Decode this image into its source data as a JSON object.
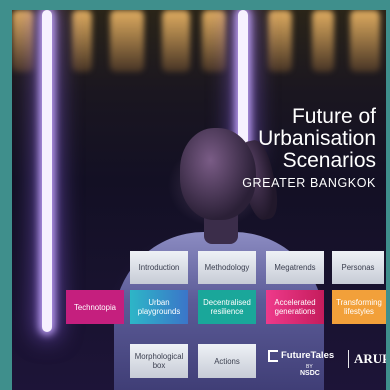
{
  "title_lines": [
    "Future of",
    "Urbanisation",
    "Scenarios"
  ],
  "subtitle": "GREATER BANGKOK",
  "nav": {
    "introduction": "Introduction",
    "methodology": "Methodology",
    "megatrends": "Megatrends",
    "personas": "Personas"
  },
  "scenarios": {
    "technotopia": "Technotopia",
    "urban_playgrounds": [
      "Urban",
      "playgrounds"
    ],
    "decentralised_resilience": [
      "Decentralised",
      "resilience"
    ],
    "accelerated_generations": [
      "Accelerated",
      "generations"
    ],
    "transforming_lifestyles": [
      "Transforming",
      "lifestyles"
    ]
  },
  "extras": {
    "morphological_box": [
      "Morphological",
      "box"
    ],
    "actions": "Actions"
  },
  "logos": {
    "futuretales": "FutureTales",
    "futuretales_by": "BY",
    "futuretales_org": "NSDC",
    "arup": "ARUP"
  },
  "colors": {
    "technotopia": "#c51f7e",
    "urban_playgrounds": "#2db6c7",
    "decentralised_resilience": "#1aa79a",
    "accelerated_generations": "#ee3a8b",
    "transforming_lifestyles": "#f2a03a",
    "frame": "#3f8f8c"
  }
}
